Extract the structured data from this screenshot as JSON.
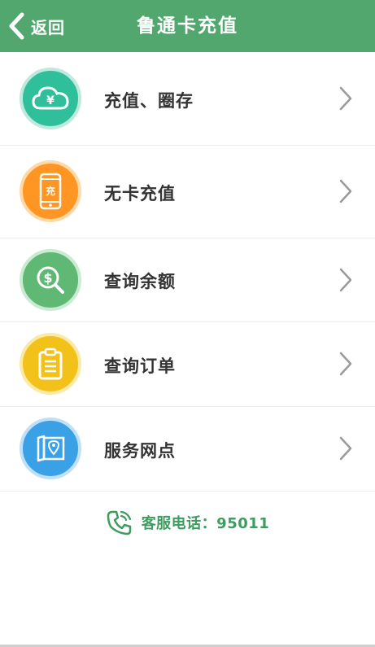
{
  "header": {
    "back_label": "返回",
    "title": "鲁通卡充值"
  },
  "menu": {
    "items": [
      {
        "label": "充值、圈存",
        "icon": "cloud-yuan-icon",
        "color": "#2fbf9a",
        "ring": "#bfe9dc"
      },
      {
        "label": "无卡充值",
        "icon": "phone-recharge-icon",
        "color": "#ff9522",
        "ring": "#ffd9a8",
        "icon_text": "充"
      },
      {
        "label": "查询余额",
        "icon": "dollar-search-icon",
        "color": "#5fb974",
        "ring": "#c9ebd2"
      },
      {
        "label": "查询订单",
        "icon": "clipboard-icon",
        "color": "#f2c21a",
        "ring": "#fbe9a8"
      },
      {
        "label": "服务网点",
        "icon": "map-pin-icon",
        "color": "#3aa1e6",
        "ring": "#bfe0f7"
      }
    ]
  },
  "footer": {
    "label": "客服电话：95011",
    "icon": "phone-icon"
  },
  "colors": {
    "header_bg": "#52a76e",
    "accent_green": "#3f9c60"
  }
}
